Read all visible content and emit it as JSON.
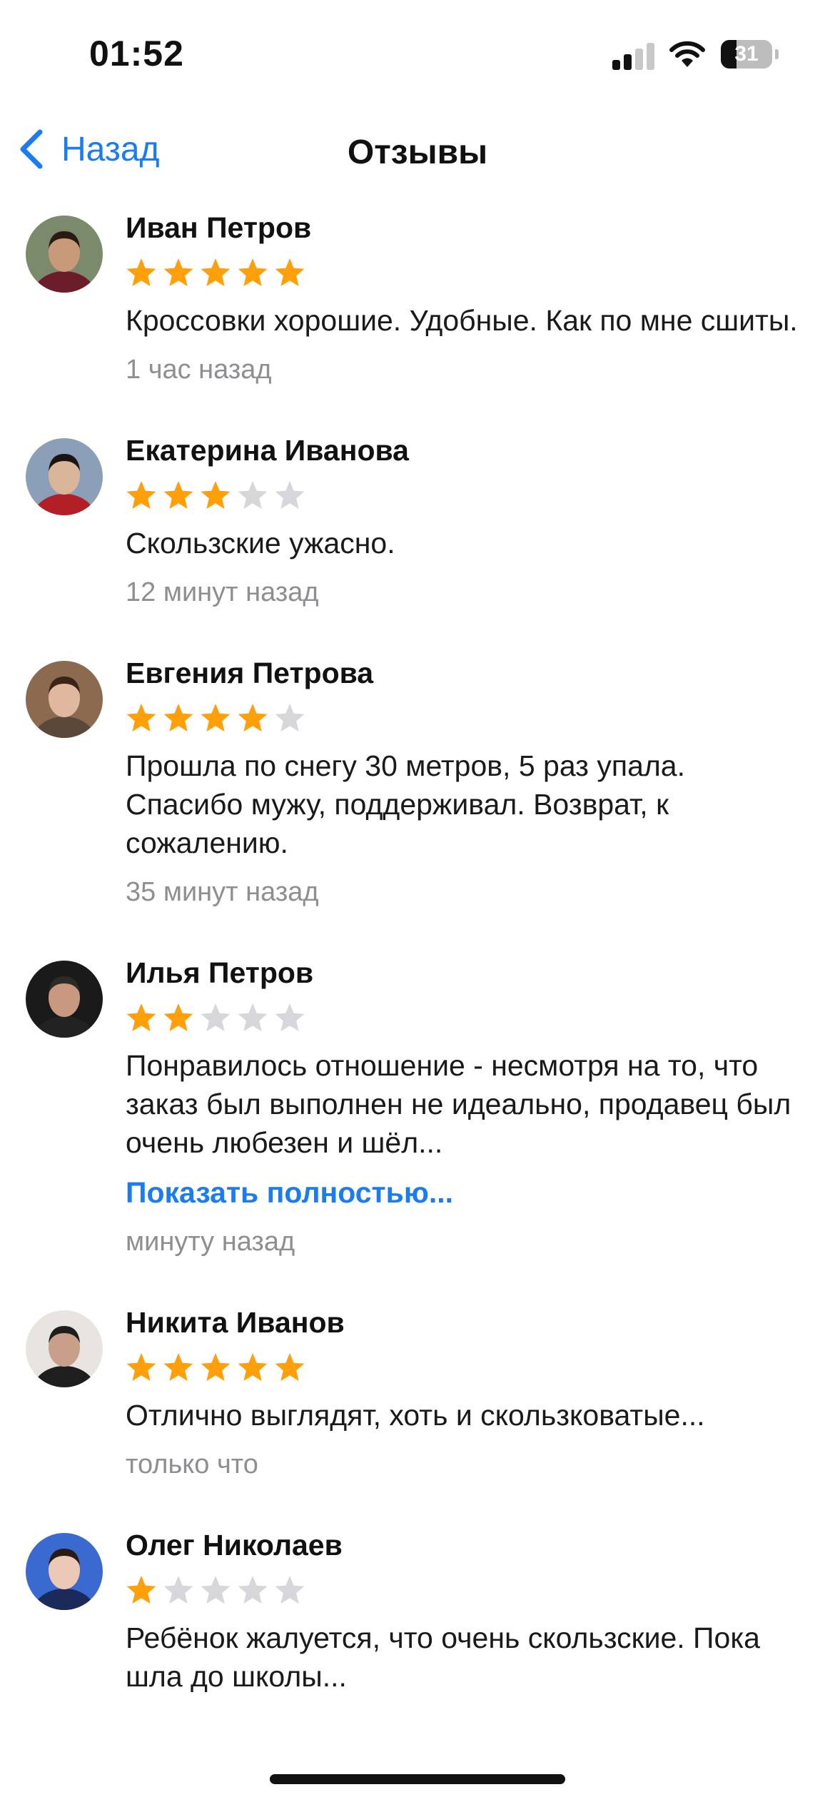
{
  "status_bar": {
    "time": "01:52",
    "battery": "31",
    "battery_level": 0.31
  },
  "nav": {
    "back_label": "Назад",
    "title": "Отзывы"
  },
  "colors": {
    "accent": "#1a7cf0",
    "star_on": "#ff9f0a",
    "star_off": "#d6d6db",
    "muted": "#8e8e93"
  },
  "reviews": [
    {
      "name": "Иван Петров",
      "rating": 5,
      "text": "Кроссовки хорошие. Удобные. Как по мне сшиты.",
      "more": "",
      "time": "1 час назад",
      "avatar_icon": "avatar-photo-man"
    },
    {
      "name": "Екатерина Иванова",
      "rating": 3,
      "text": "Скользские ужасно.",
      "more": "",
      "time": "12 минут назад",
      "avatar_icon": "avatar-photo-woman"
    },
    {
      "name": "Евгения Петрова",
      "rating": 4,
      "text": "Прошла по снегу 30 метров, 5 раз упала. Спасибо мужу, поддерживал. Возврат, к сожалению.",
      "more": "",
      "time": "35 минут назад",
      "avatar_icon": "avatar-photo-woman-glasses"
    },
    {
      "name": "Илья Петров",
      "rating": 2,
      "text": "Понравилось отношение - несмотря на то, что заказ был выполнен не идеально, продавец был очень любезен и шёл...",
      "more": "Показать полностью...",
      "time": "минуту назад",
      "avatar_icon": "avatar-photo-man-suit"
    },
    {
      "name": "Никита Иванов",
      "rating": 5,
      "text": "Отлично выглядят, хоть и скользковатые...",
      "more": "",
      "time": "только что",
      "avatar_icon": "avatar-photo-man-sunglasses"
    },
    {
      "name": "Олег Николаев",
      "rating": 1,
      "text": "Ребёнок жалуется, что очень скользские. Пока шла до школы...",
      "more": "",
      "time": "",
      "avatar_icon": "avatar-photo-boy"
    }
  ]
}
